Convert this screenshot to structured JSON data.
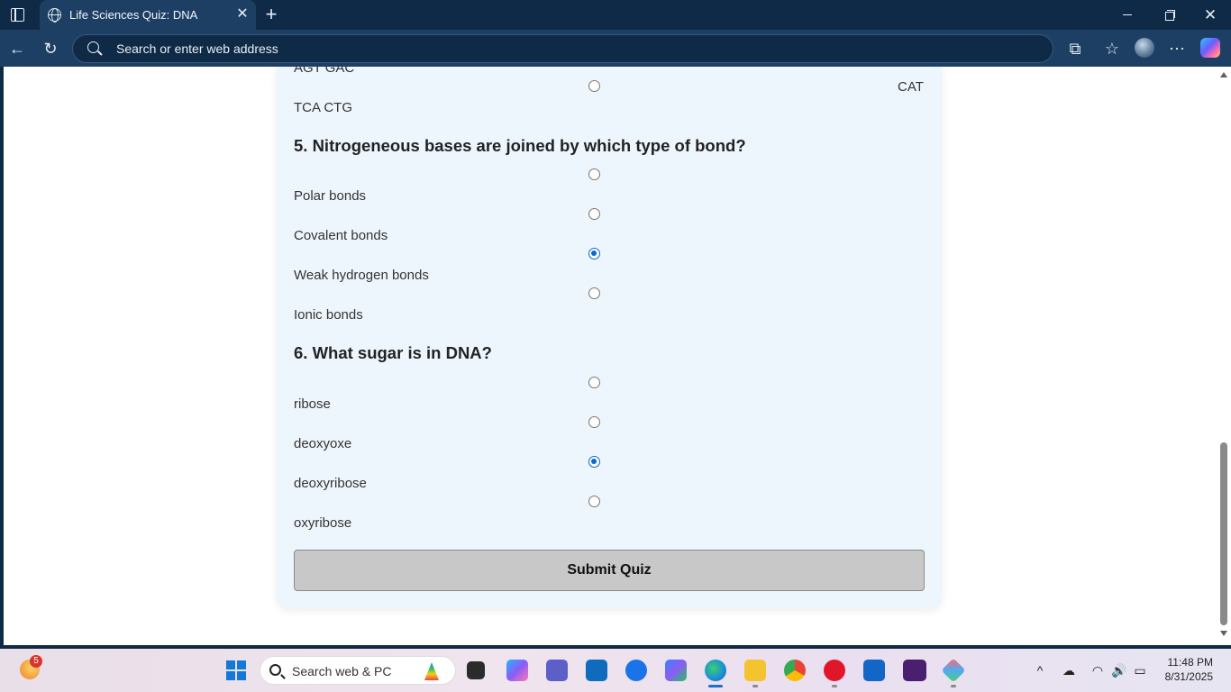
{
  "browser": {
    "tab_title": "Life Sciences Quiz: DNA",
    "address_placeholder": "Search or enter web address"
  },
  "quiz": {
    "q4_partial": {
      "options": [
        {
          "label": "AGT GAC"
        },
        {
          "label": "TCA CTG"
        }
      ],
      "right_label": "CAT"
    },
    "q5": {
      "text": "5. Nitrogeneous bases are joined by which type of bond?",
      "options": [
        {
          "label": "Polar bonds",
          "checked": false
        },
        {
          "label": "Covalent bonds",
          "checked": false
        },
        {
          "label": "Weak hydrogen bonds",
          "checked": true
        },
        {
          "label": "Ionic bonds",
          "checked": false
        }
      ]
    },
    "q6": {
      "text": "6. What sugar is in DNA?",
      "options": [
        {
          "label": "ribose",
          "checked": false
        },
        {
          "label": "deoxyoxe",
          "checked": false
        },
        {
          "label": "deoxyribose",
          "checked": true
        },
        {
          "label": "oxyribose",
          "checked": false
        }
      ]
    },
    "submit_label": "Submit Quiz"
  },
  "taskbar": {
    "weather_badge": "5",
    "search_label": "Search web & PC",
    "time": "11:48 PM",
    "date": "8/31/2025",
    "apps": [
      "file-manager",
      "copilot",
      "teams",
      "outlook",
      "bluetooth",
      "m365",
      "edge",
      "file-explorer",
      "chrome",
      "opera",
      "app-a",
      "welib",
      "app-b"
    ]
  },
  "colors": {
    "accent": "#0a66d0",
    "card_bg": "#eef6fd",
    "browser_frame": "#1d3f63"
  }
}
